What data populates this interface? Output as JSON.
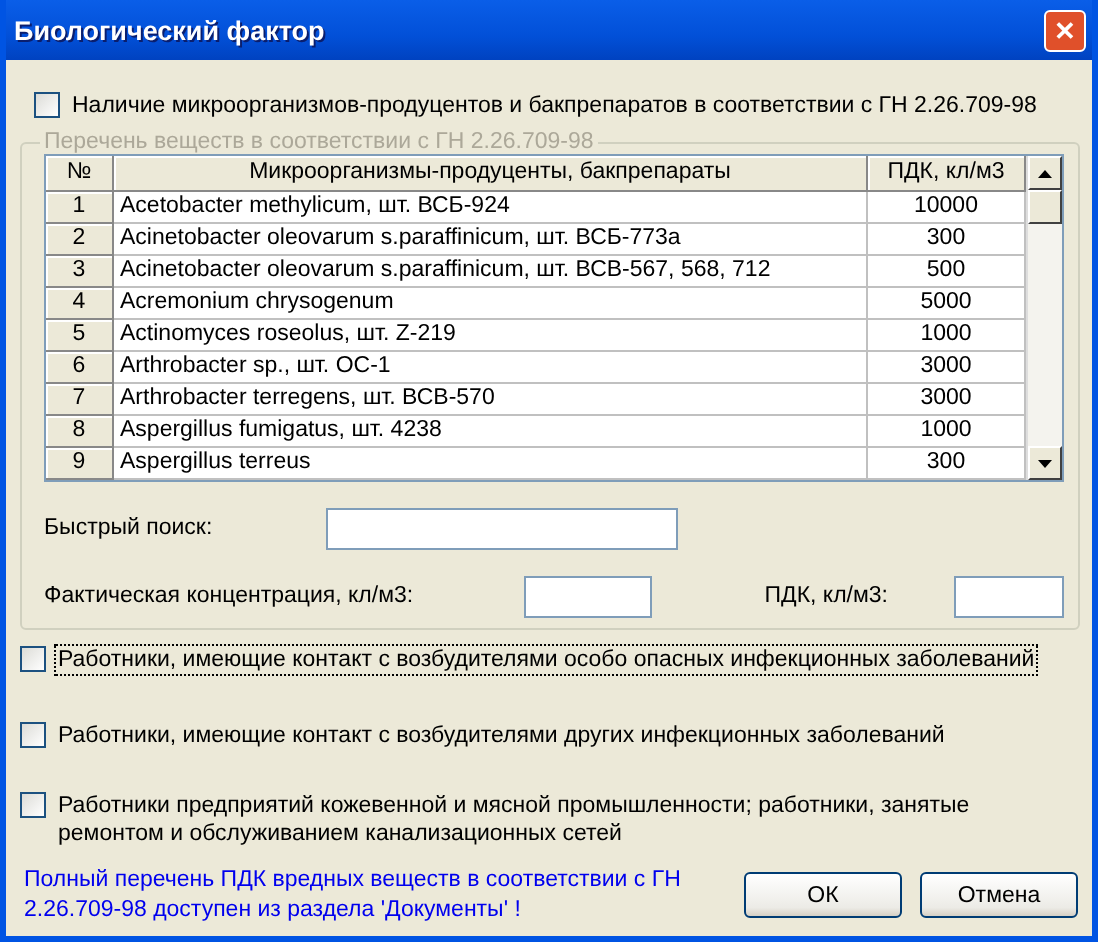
{
  "window": {
    "title": "Биологический фактор",
    "close_glyph": "✕"
  },
  "main_check": {
    "label": "Наличие микроорганизмов-продуцентов и бакпрепаратов в соответствии с ГН 2.26.709-98",
    "checked": false
  },
  "group": {
    "title": "Перечень веществ в соответствии с ГН 2.26.709-98",
    "disabled": true
  },
  "table": {
    "columns": [
      "№",
      "Микроорганизмы-продуценты, бакпрепараты",
      "ПДК, кл/м3"
    ],
    "rows": [
      {
        "num": "1",
        "name": "Acetobacter methylicum, шт. ВСБ-924",
        "pdk": "10000"
      },
      {
        "num": "2",
        "name": "Acinetobacter oleovarum s.paraffinicum, шт. ВСБ-773а",
        "pdk": "300"
      },
      {
        "num": "3",
        "name": "Acinetobacter oleovarum s.paraffinicum, шт. ВСВ-567, 568, 712",
        "pdk": "500"
      },
      {
        "num": "4",
        "name": "Acremonium chrysogenum",
        "pdk": "5000"
      },
      {
        "num": "5",
        "name": "Actinomyces roseolus, шт. Z-219",
        "pdk": "1000"
      },
      {
        "num": "6",
        "name": "Arthrobacter sp., шт. ОС-1",
        "pdk": "3000"
      },
      {
        "num": "7",
        "name": "Arthrobacter terregens, шт. ВСВ-570",
        "pdk": "3000"
      },
      {
        "num": "8",
        "name": "Aspergillus fumigatus, шт. 4238",
        "pdk": "1000"
      },
      {
        "num": "9",
        "name": "Aspergillus terreus",
        "pdk": "300"
      }
    ]
  },
  "quick_search": {
    "label": "Быстрый поиск:"
  },
  "actual_concentration": {
    "label": "Фактическая концентрация,  кл/м3:"
  },
  "pdk_field": {
    "label": "ПДК,  кл/м3:"
  },
  "checks": [
    {
      "label": "Работники, имеющие контакт с возбудителями особо опасных инфекционных заболеваний",
      "checked": false,
      "focused": true
    },
    {
      "label": "Работники, имеющие контакт с возбудителями других инфекционных заболеваний",
      "checked": false,
      "focused": false
    },
    {
      "label": "Работники предприятий кожевенной и мясной промышленности; работники, занятые ремонтом и обслуживанием канализационных сетей",
      "checked": false,
      "focused": false
    }
  ],
  "note": "Полный перечень ПДК вредных веществ в соответствии с ГН 2.26.709-98 доступен из раздела 'Документы' !",
  "buttons": [
    "ОК",
    "Отмена"
  ]
}
